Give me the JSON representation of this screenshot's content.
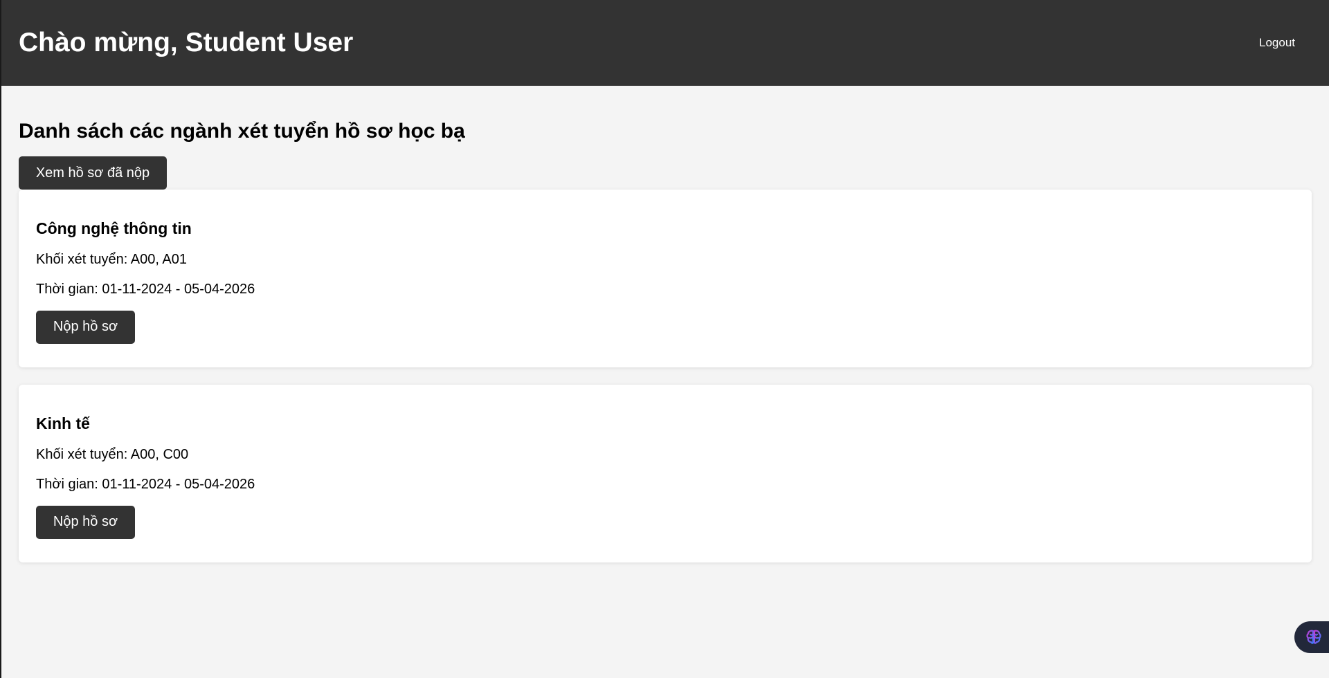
{
  "header": {
    "welcome": "Chào mừng, Student User",
    "logout_label": "Logout"
  },
  "main": {
    "heading": "Danh sách các ngành xét tuyển hồ sơ học bạ",
    "view_submitted_label": "Xem hồ sơ đã nộp"
  },
  "majors": [
    {
      "name": "Công nghệ thông tin",
      "blocks": "Khối xét tuyển: A00, A01",
      "period": "Thời gian: 01-11-2024 - 05-04-2026",
      "submit_label": "Nộp hồ sơ"
    },
    {
      "name": "Kinh tế",
      "blocks": "Khối xét tuyển: A00, C00",
      "period": "Thời gian: 01-11-2024 - 05-04-2026",
      "submit_label": "Nộp hồ sơ"
    }
  ],
  "floating": {
    "icon": "brain-icon",
    "gradient": [
      "#c23bd4",
      "#3b7bff"
    ]
  },
  "colors": {
    "header_bg": "#333333",
    "page_bg": "#f4f4f4",
    "button_bg": "#333333",
    "card_bg": "#ffffff"
  }
}
